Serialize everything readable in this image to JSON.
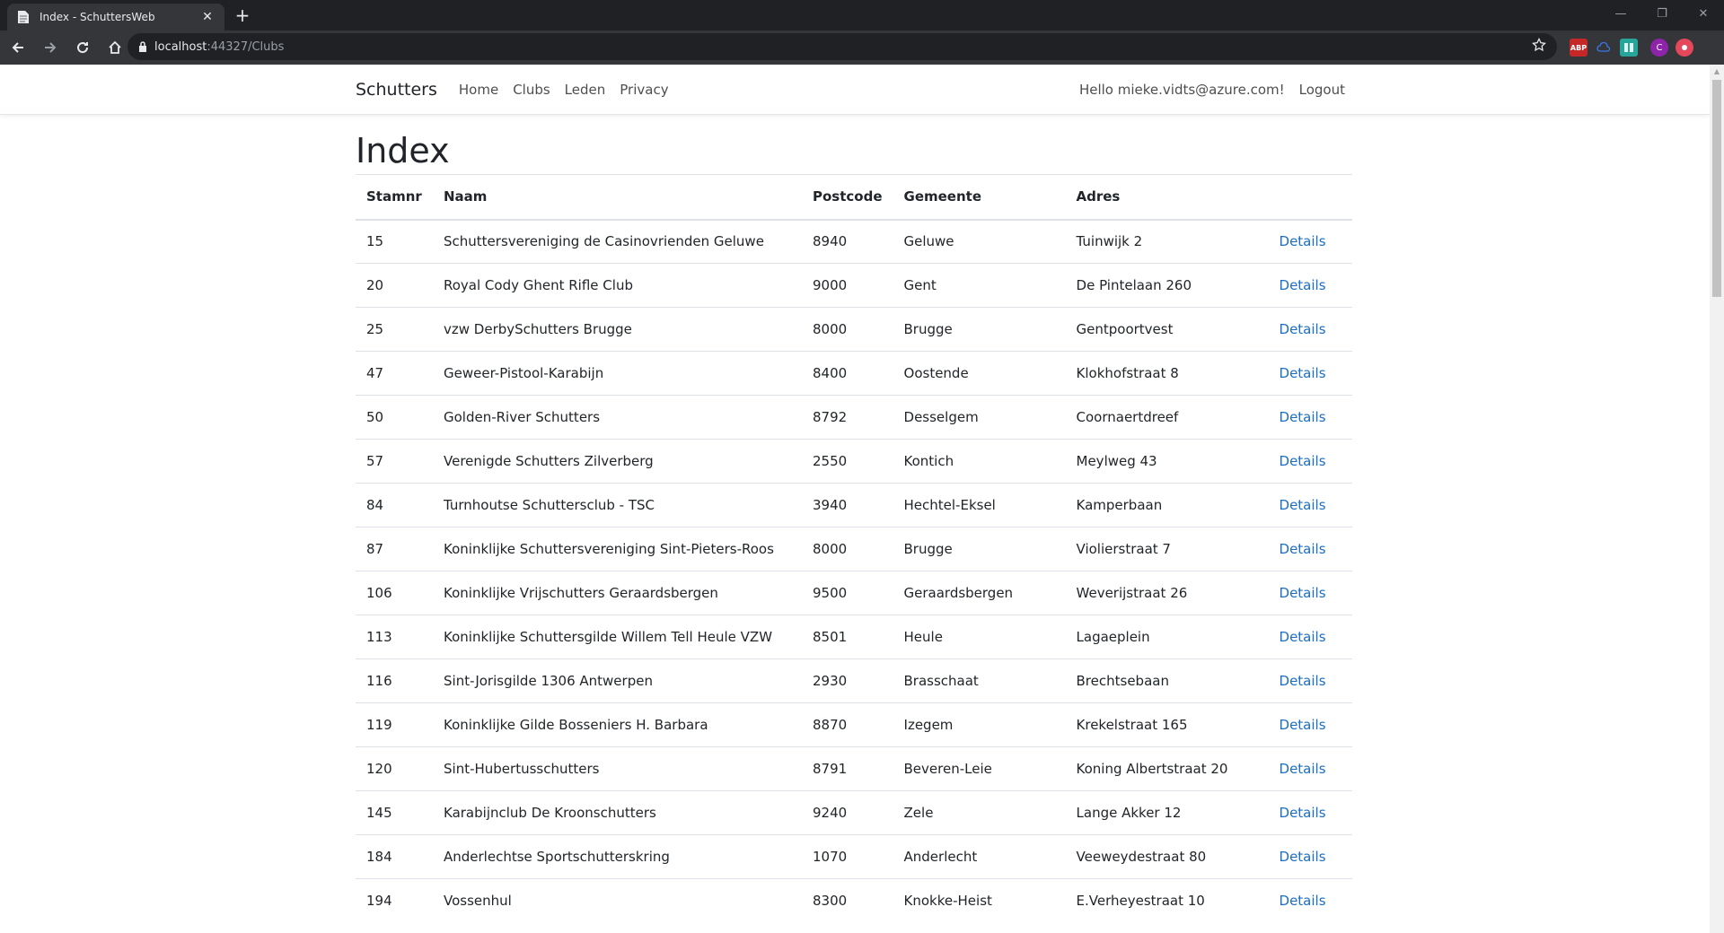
{
  "browser": {
    "tab_title": "Index - SchuttersWeb",
    "url_host": "localhost",
    "url_rest": ":44327/Clubs",
    "avatar_letter": "C",
    "ext_abp": "ABP"
  },
  "nav": {
    "brand": "Schutters",
    "links": [
      "Home",
      "Clubs",
      "Leden",
      "Privacy"
    ],
    "greeting": "Hello mieke.vidts@azure.com!",
    "logout": "Logout"
  },
  "page": {
    "title": "Index",
    "headers": [
      "Stamnr",
      "Naam",
      "Postcode",
      "Gemeente",
      "Adres"
    ],
    "details_label": "Details",
    "rows": [
      [
        "15",
        "Schuttersvereniging de Casinovrienden Geluwe",
        "8940",
        "Geluwe",
        "Tuinwijk 2"
      ],
      [
        "20",
        "Royal Cody Ghent Rifle Club",
        "9000",
        "Gent",
        "De Pintelaan 260"
      ],
      [
        "25",
        "vzw DerbySchutters Brugge",
        "8000",
        "Brugge",
        "Gentpoortvest"
      ],
      [
        "47",
        "Geweer-Pistool-Karabijn",
        "8400",
        "Oostende",
        "Klokhofstraat 8"
      ],
      [
        "50",
        "Golden-River Schutters",
        "8792",
        "Desselgem",
        "Coornaertdreef"
      ],
      [
        "57",
        "Verenigde Schutters Zilverberg",
        "2550",
        "Kontich",
        "Meylweg 43"
      ],
      [
        "84",
        "Turnhoutse Schuttersclub - TSC",
        "3940",
        "Hechtel-Eksel",
        "Kamperbaan"
      ],
      [
        "87",
        "Koninklijke Schuttersvereniging Sint-Pieters-Roos",
        "8000",
        "Brugge",
        "Violierstraat 7"
      ],
      [
        "106",
        "Koninklijke Vrijschutters Geraardsbergen",
        "9500",
        "Geraardsbergen",
        "Weverijstraat 26"
      ],
      [
        "113",
        "Koninklijke Schuttersgilde Willem Tell Heule VZW",
        "8501",
        "Heule",
        "Lagaeplein"
      ],
      [
        "116",
        "Sint-Jorisgilde 1306 Antwerpen",
        "2930",
        "Brasschaat",
        "Brechtsebaan"
      ],
      [
        "119",
        "Koninklijke Gilde Bosseniers H. Barbara",
        "8870",
        "Izegem",
        "Krekelstraat 165"
      ],
      [
        "120",
        "Sint-Hubertusschutters",
        "8791",
        "Beveren-Leie",
        "Koning Albertstraat 20"
      ],
      [
        "145",
        "Karabijnclub De Kroonschutters",
        "9240",
        "Zele",
        "Lange Akker 12"
      ],
      [
        "184",
        "Anderlechtse Sportschutterskring",
        "1070",
        "Anderlecht",
        "Veeweydestraat 80"
      ],
      [
        "194",
        "Vossenhul",
        "8300",
        "Knokke-Heist",
        "E.Verheyestraat 10"
      ]
    ]
  }
}
